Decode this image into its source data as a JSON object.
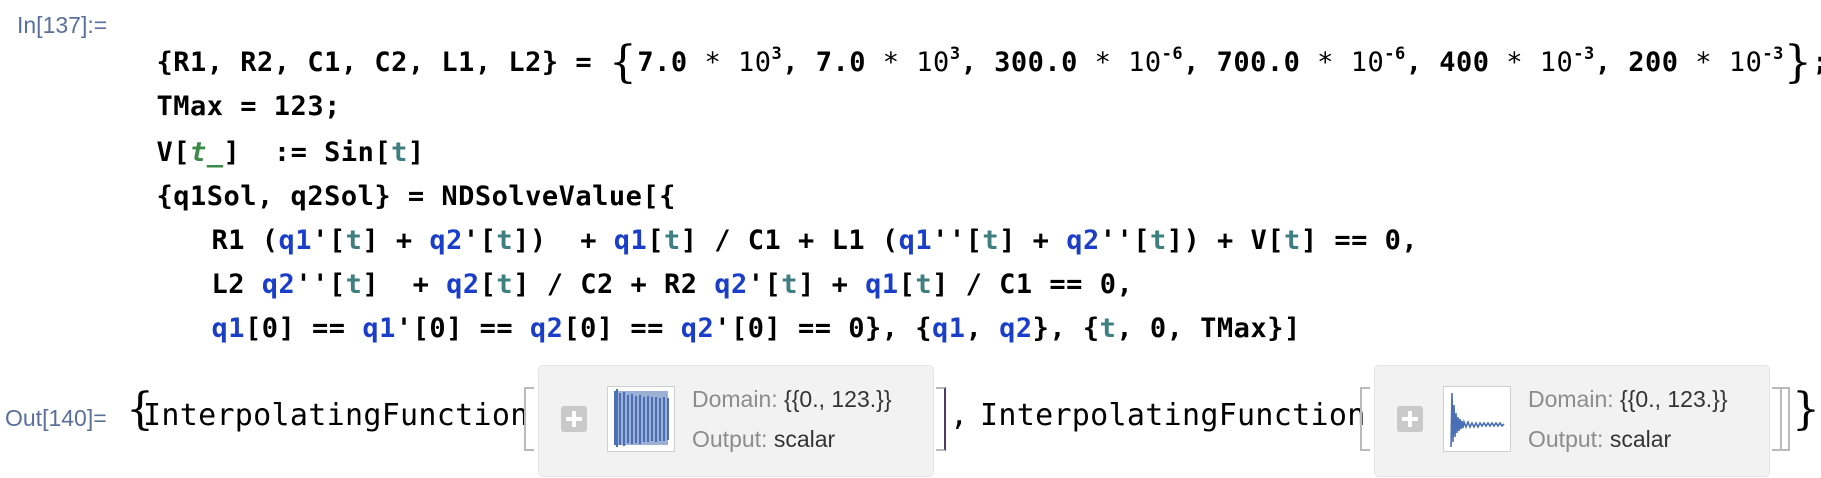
{
  "input": {
    "label": "In[137]:=",
    "lines": {
      "l1": {
        "lhs": "{R1, R2, C1, C2, L1, L2} = ",
        "open": "{",
        "m1": "7.0",
        "e1": "3",
        "m2": "7.0",
        "e2": "3",
        "m3": "300.0",
        "e3": "-6",
        "m4": "700.0",
        "e4": "-6",
        "m5": "400",
        "e5": "-3",
        "m6": "200",
        "e6": "-3",
        "times10": " * 10",
        "sep": ", ",
        "close": "}",
        "end": ";"
      },
      "l2": "TMax = 123;",
      "l3": {
        "a": "V[",
        "pat": "t_",
        "b": "]  := Sin[",
        "t": "t",
        "c": "]"
      },
      "l4": {
        "a": "{q1Sol, q2Sol} = NDSolveValue[{"
      },
      "l5": {
        "p1": "R1 (",
        "q1": "q1",
        "p2": "'[",
        "t1": "t",
        "p3": "] + ",
        "q2": "q2",
        "p4": "'[",
        "t2": "t",
        "p5": "])  + ",
        "q1b": "q1",
        "p6": "[",
        "t3": "t",
        "p7": "] / C1 + L1 (",
        "q1c": "q1",
        "p8": "''[",
        "t4": "t",
        "p9": "] + ",
        "q2b": "q2",
        "p10": "''[",
        "t5": "t",
        "p11": "]) + V[",
        "t6": "t",
        "p12": "] == 0,"
      },
      "l6": {
        "p1": "L2 ",
        "q2": "q2",
        "p2": "''[",
        "t1": "t",
        "p3": "]  + ",
        "q2b": "q2",
        "p4": "[",
        "t2": "t",
        "p5": "] / C2 + R2 ",
        "q2c": "q2",
        "p6": "'[",
        "t3": "t",
        "p7": "] + ",
        "q1": "q1",
        "p8": "[",
        "t4": "t",
        "p9": "] / C1 == 0,"
      },
      "l7": {
        "q1": "q1",
        "p1": "[0] == ",
        "q1b": "q1",
        "p2": "'[0] == ",
        "q2": "q2",
        "p3": "[0] == ",
        "q2b": "q2",
        "p4": "'[0] == 0}, {",
        "q1c": "q1",
        "p5": ", ",
        "q2c": "q2",
        "p6": "}, {",
        "t": "t",
        "p7": ", 0, TMax}]"
      }
    }
  },
  "output": {
    "label": "Out[140]=",
    "comma": ",",
    "functions": [
      {
        "name": "InterpolatingFunction",
        "domain_label": "Domain:",
        "domain_value": "{{0., 123.}}",
        "output_label": "Output:",
        "output_value": "scalar"
      },
      {
        "name": "InterpolatingFunction",
        "domain_label": "Domain:",
        "domain_value": "{{0., 123.}}",
        "output_label": "Output:",
        "output_value": "scalar"
      }
    ]
  },
  "colors": {
    "symbol_blue": "#1a3ec8",
    "symbol_teal": "#3f7f7f",
    "pattern_green": "#3c8a48",
    "label_blue": "#5a6f9a",
    "plot_blue": "#4a6fb5"
  },
  "icons": [
    "plus-icon",
    "plot-thumbnail"
  ]
}
